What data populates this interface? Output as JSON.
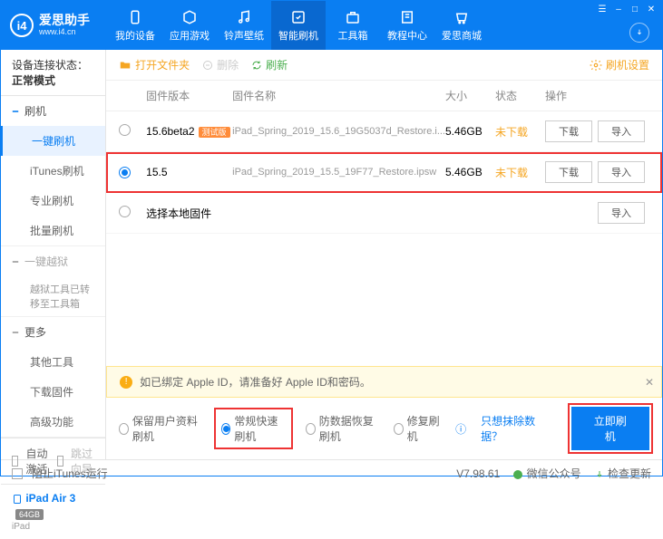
{
  "header": {
    "brand": "爱思助手",
    "url": "www.i4.cn",
    "nav": [
      "我的设备",
      "应用游戏",
      "铃声壁纸",
      "智能刷机",
      "工具箱",
      "教程中心",
      "爱思商城"
    ]
  },
  "status": {
    "label": "设备连接状态：",
    "value": "正常模式"
  },
  "sidebar": {
    "s1": {
      "head": "刷机",
      "items": [
        "一键刷机",
        "iTunes刷机",
        "专业刷机",
        "批量刷机"
      ]
    },
    "s2": {
      "head": "一键越狱",
      "note": "越狱工具已转移至工具箱"
    },
    "s3": {
      "head": "更多",
      "items": [
        "其他工具",
        "下载固件",
        "高级功能"
      ]
    },
    "auto": {
      "a": "自动激活",
      "b": "跳过向导"
    }
  },
  "device": {
    "name": "iPad Air 3",
    "storage": "64GB",
    "type": "iPad"
  },
  "toolbar": {
    "open": "打开文件夹",
    "del": "删除",
    "refresh": "刷新",
    "settings": "刷机设置"
  },
  "table": {
    "head": {
      "ver": "固件版本",
      "name": "固件名称",
      "size": "大小",
      "stat": "状态",
      "act": "操作"
    },
    "rows": [
      {
        "ver": "15.6beta2",
        "beta": "测试版",
        "name": "iPad_Spring_2019_15.6_19G5037d_Restore.i...",
        "size": "5.46GB",
        "stat": "未下载",
        "selected": false
      },
      {
        "ver": "15.5",
        "beta": "",
        "name": "iPad_Spring_2019_15.5_19F77_Restore.ipsw",
        "size": "5.46GB",
        "stat": "未下载",
        "selected": true
      }
    ],
    "local": "选择本地固件",
    "btn_dl": "下载",
    "btn_imp": "导入"
  },
  "warn": "如已绑定 Apple ID，请准备好 Apple ID和密码。",
  "modes": {
    "m1": "保留用户资料刷机",
    "m2": "常规快速刷机",
    "m3": "防数据恢复刷机",
    "m4": "修复刷机",
    "link": "只想抹除数据？",
    "go": "立即刷机",
    "info": "ⓘ"
  },
  "footer": {
    "block": "阻止iTunes运行",
    "ver": "V7.98.61",
    "wx": "微信公众号",
    "upd": "检查更新"
  }
}
